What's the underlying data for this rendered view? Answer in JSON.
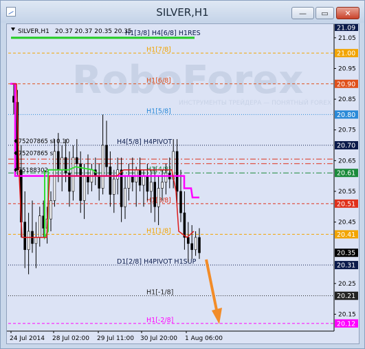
{
  "window": {
    "title": "SILVER,H1",
    "minimize_icon": "minimize-icon",
    "maximize_icon": "maximize-icon",
    "close_icon": "close-icon"
  },
  "chart_header": {
    "symbol": "SILVER,H1",
    "ohlc": "20.37 20.37 20.35 20.35"
  },
  "watermark": {
    "brand": "RoboForex",
    "tagline": "ИНСТРУМЕНТЫ ТРЕЙДЕРА — ПОНЯТНЫЙ FOREX"
  },
  "colors": {
    "background": "#dce3f5",
    "candles": "#000000",
    "h4_line": "#ff00ff",
    "h1_line": "#cc0000",
    "green_line": "#33dd33",
    "arrow": "#f28c28"
  },
  "chart_data": {
    "type": "candlestick",
    "ylim": [
      20.1,
      21.1
    ],
    "y_ticks": [
      "21.09",
      "21.05",
      "21.00",
      "20.95",
      "20.90",
      "20.85",
      "20.80",
      "20.75",
      "20.70",
      "20.65",
      "20.61",
      "20.55",
      "20.51",
      "20.45",
      "20.41",
      "20.35",
      "20.31",
      "20.25",
      "20.21",
      "20.15",
      "20.12"
    ],
    "x_ticks": [
      "24 Jul 2014",
      "28 Jul 02:00",
      "29 Jul 11:00",
      "30 Jul 20:00",
      "1 Aug 06:00"
    ],
    "levels": [
      {
        "label": "H1[7/8]",
        "value": 21.0,
        "color": "#f2a400",
        "style": "dashed",
        "axis_label": "21.00"
      },
      {
        "label": "H1[6/8]",
        "value": 20.9,
        "color": "#e0501a",
        "style": "dashed",
        "axis_label": "20.90"
      },
      {
        "label": "H1[5/8]",
        "value": 20.8,
        "color": "#2a8ad8",
        "style": "dotted",
        "axis_label": "20.80"
      },
      {
        "label": "H4[5/8] H4PIVOT",
        "value": 20.7,
        "color": "#0a1a4a",
        "style": "dotted",
        "axis_label": "20.70"
      },
      {
        "label": "",
        "value": 20.655,
        "color": "#e0301a",
        "style": "dashdot",
        "axis_label": ""
      },
      {
        "label": "",
        "value": 20.64,
        "color": "#e0301a",
        "style": "dashdot",
        "axis_label": ""
      },
      {
        "label": "H1[4/8]",
        "value": 20.61,
        "color": "#1a8a3a",
        "style": "dashdot",
        "axis_label": "20.61"
      },
      {
        "label": "H1[3/8]",
        "value": 20.51,
        "color": "#e0301a",
        "style": "dashed",
        "axis_label": "20.51"
      },
      {
        "label": "H1[1/8]",
        "value": 20.41,
        "color": "#f2a400",
        "style": "dashed",
        "axis_label": "20.41"
      },
      {
        "label": "D1[2/8] H4PIVOT H1SUP",
        "value": 20.31,
        "color": "#0a1a4a",
        "style": "dotted",
        "axis_label": "20.31"
      },
      {
        "label": "H1[-1/8]",
        "value": 20.21,
        "color": "#222222",
        "style": "dotted",
        "axis_label": "20.21"
      },
      {
        "label": "H1[-2/8]",
        "value": 20.12,
        "color": "#ff00ff",
        "style": "dashed",
        "axis_label": "20.12"
      }
    ],
    "current_price": "20.35",
    "top_level": {
      "label": "H1[3/8] H4[6/8] H1RES",
      "value": 21.05,
      "axis_label": "21.09"
    },
    "annotations": [
      {
        "text": "75207865 sl 0.10",
        "value": 20.705
      },
      {
        "text": "75207865 s",
        "value": 20.665
      },
      {
        "text": "75188302",
        "value": 20.61
      }
    ],
    "candles": [
      [
        20.86,
        20.9,
        20.8,
        20.84
      ],
      [
        20.84,
        20.88,
        20.6,
        20.62
      ],
      [
        20.62,
        20.7,
        20.4,
        20.45
      ],
      [
        20.45,
        20.55,
        20.3,
        20.36
      ],
      [
        20.36,
        20.48,
        20.28,
        20.42
      ],
      [
        20.42,
        20.52,
        20.35,
        20.38
      ],
      [
        20.38,
        20.45,
        20.3,
        20.4
      ],
      [
        20.4,
        20.5,
        20.37,
        20.47
      ],
      [
        20.47,
        20.52,
        20.4,
        20.43
      ],
      [
        20.43,
        20.5,
        20.38,
        20.46
      ],
      [
        20.46,
        20.55,
        20.42,
        20.52
      ],
      [
        20.52,
        20.72,
        20.5,
        20.68
      ],
      [
        20.68,
        20.74,
        20.58,
        20.62
      ],
      [
        20.62,
        20.7,
        20.55,
        20.66
      ],
      [
        20.66,
        20.72,
        20.58,
        20.61
      ],
      [
        20.61,
        20.68,
        20.5,
        20.55
      ],
      [
        20.55,
        20.7,
        20.52,
        20.66
      ],
      [
        20.66,
        20.72,
        20.6,
        20.64
      ],
      [
        20.64,
        20.68,
        20.48,
        20.52
      ],
      [
        20.52,
        20.64,
        20.46,
        20.6
      ],
      [
        20.6,
        20.67,
        20.54,
        20.58
      ],
      [
        20.58,
        20.64,
        20.55,
        20.62
      ],
      [
        20.62,
        20.66,
        20.57,
        20.6
      ],
      [
        20.6,
        20.64,
        20.52,
        20.56
      ],
      [
        20.56,
        20.8,
        20.54,
        20.7
      ],
      [
        20.7,
        20.78,
        20.6,
        20.63
      ],
      [
        20.63,
        20.68,
        20.5,
        20.54
      ],
      [
        20.54,
        20.62,
        20.48,
        20.59
      ],
      [
        20.59,
        20.66,
        20.54,
        20.62
      ],
      [
        20.62,
        20.66,
        20.45,
        20.5
      ],
      [
        20.5,
        20.6,
        20.46,
        20.56
      ],
      [
        20.56,
        20.64,
        20.52,
        20.6
      ],
      [
        20.6,
        20.66,
        20.55,
        20.58
      ],
      [
        20.58,
        20.63,
        20.5,
        20.62
      ],
      [
        20.62,
        20.66,
        20.55,
        20.57
      ],
      [
        20.57,
        20.62,
        20.5,
        20.6
      ],
      [
        20.6,
        20.64,
        20.52,
        20.55
      ],
      [
        20.55,
        20.62,
        20.48,
        20.58
      ],
      [
        20.58,
        20.63,
        20.45,
        20.5
      ],
      [
        20.5,
        20.6,
        20.44,
        20.56
      ],
      [
        20.56,
        20.62,
        20.52,
        20.58
      ],
      [
        20.58,
        20.64,
        20.54,
        20.61
      ],
      [
        20.61,
        20.66,
        20.56,
        20.59
      ],
      [
        20.59,
        20.72,
        20.56,
        20.68
      ],
      [
        20.68,
        20.72,
        20.5,
        20.55
      ],
      [
        20.55,
        20.62,
        20.45,
        20.48
      ],
      [
        20.48,
        20.55,
        20.36,
        20.4
      ],
      [
        20.4,
        20.45,
        20.32,
        20.38
      ],
      [
        20.38,
        20.44,
        20.33,
        20.36
      ],
      [
        20.36,
        20.42,
        20.34,
        20.4
      ],
      [
        20.4,
        20.43,
        20.33,
        20.35
      ]
    ]
  }
}
